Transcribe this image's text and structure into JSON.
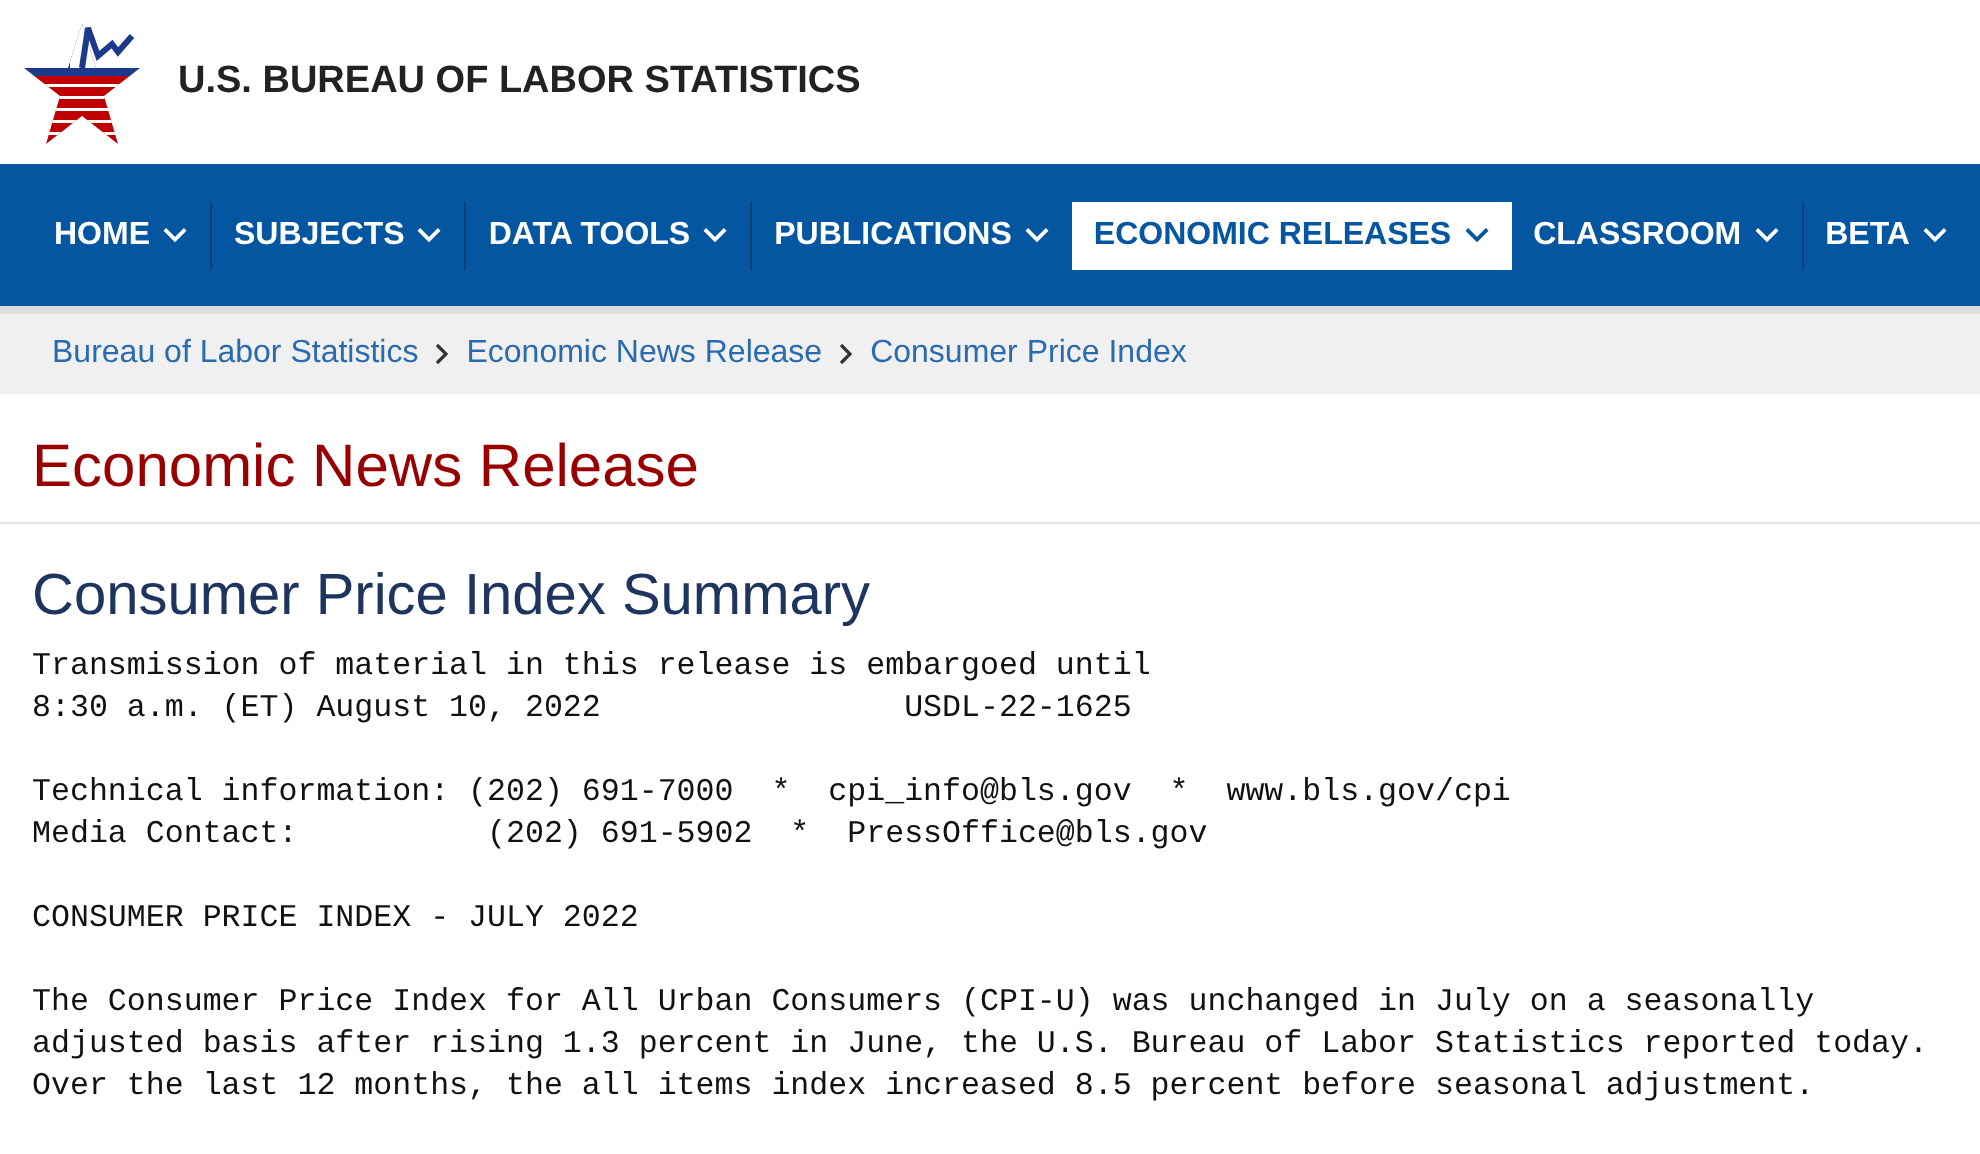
{
  "header": {
    "title": "U.S. BUREAU OF LABOR STATISTICS"
  },
  "nav": [
    {
      "label": "HOME",
      "selected": false
    },
    {
      "label": "SUBJECTS",
      "selected": false
    },
    {
      "label": "DATA TOOLS",
      "selected": false
    },
    {
      "label": "PUBLICATIONS",
      "selected": false
    },
    {
      "label": "ECONOMIC RELEASES",
      "selected": true
    },
    {
      "label": "CLASSROOM",
      "selected": false
    },
    {
      "label": "BETA",
      "selected": false
    }
  ],
  "breadcrumb": [
    "Bureau of Labor Statistics",
    "Economic News Release",
    "Consumer Price Index"
  ],
  "page_title": "Economic News Release",
  "release_title": "Consumer Price Index Summary",
  "release_blocks": [
    "Transmission of material in this release is embargoed until\n8:30 a.m. (ET) August 10, 2022                USDL-22-1625",
    "Technical information: (202) 691-7000  *  cpi_info@bls.gov  *  www.bls.gov/cpi\nMedia Contact:          (202) 691-5902  *  PressOffice@bls.gov",
    "CONSUMER PRICE INDEX - JULY 2022",
    "The Consumer Price Index for All Urban Consumers (CPI-U) was unchanged in July on a seasonally\nadjusted basis after rising 1.3 percent in June, the U.S. Bureau of Labor Statistics reported today.\nOver the last 12 months, the all items index increased 8.5 percent before seasonal adjustment."
  ]
}
